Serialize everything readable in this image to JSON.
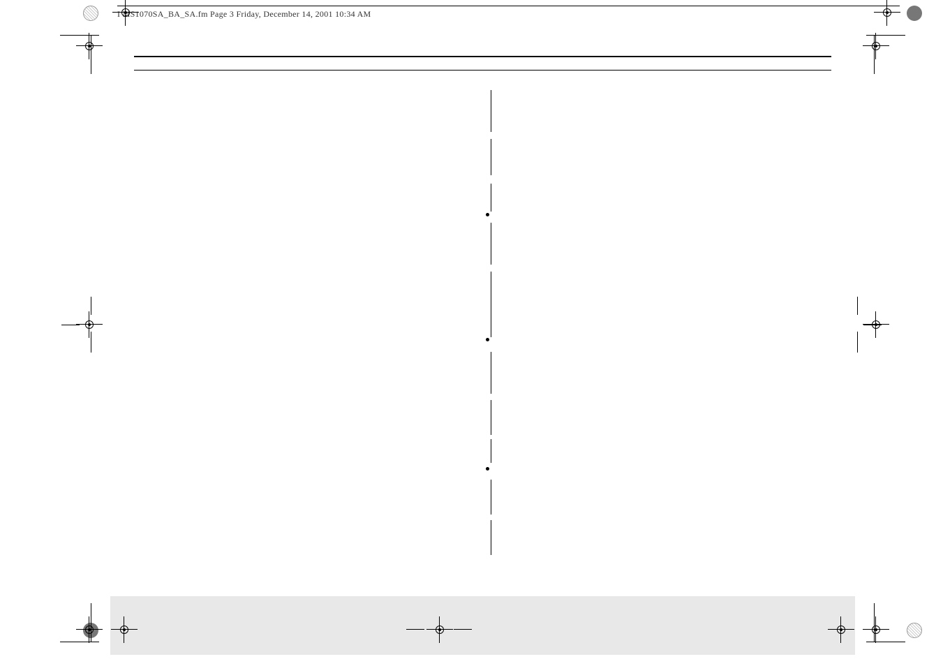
{
  "header": {
    "file_label": "I MS1070SA_BA_SA.fm  Page 3  Friday, December 14, 2001  10:34 AM"
  }
}
